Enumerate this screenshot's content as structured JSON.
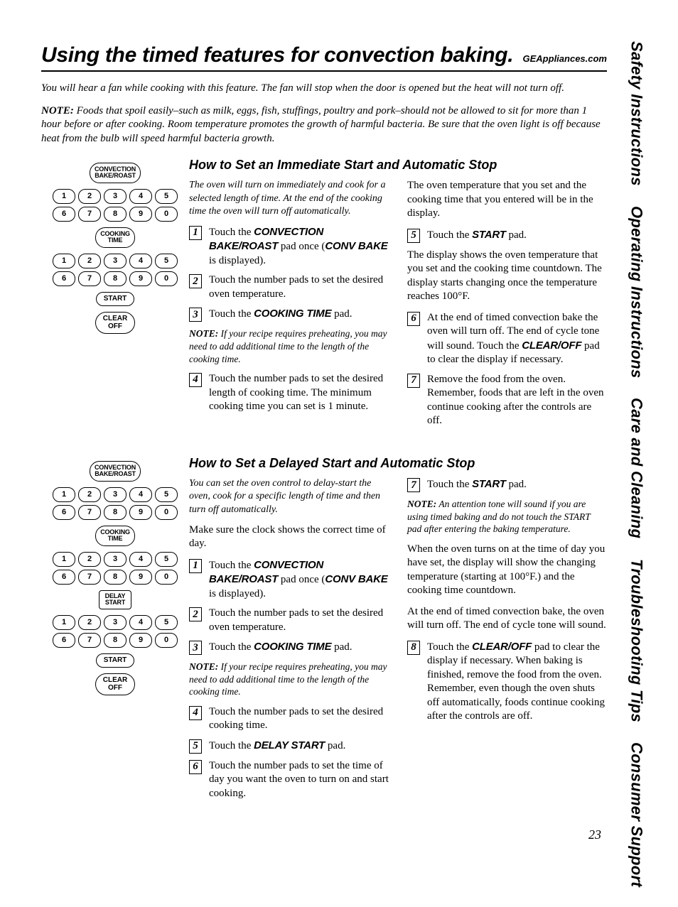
{
  "page": {
    "title": "Using the timed features for convection baking.",
    "site": "GEAppliances.com",
    "page_number": "23"
  },
  "tabs": [
    "Safety Instructions",
    "Operating Instructions",
    "Care and Cleaning",
    "Troubleshooting Tips",
    "Consumer Support"
  ],
  "intro": {
    "p1": "You will hear a fan while cooking with this feature. The fan will stop when the door is opened but the heat will not turn off.",
    "note_label": "NOTE:",
    "note_body": " Foods that spoil easily–such as milk, eggs, fish, stuffings, poultry and pork–should not be allowed to sit for more than 1 hour before or after cooking. Room temperature promotes the growth of harmful bacteria. Be sure that the oven light is off because heat from the bulb will speed harmful bacteria growth."
  },
  "buttons": {
    "conv": "CONVECTION\nBAKE/ROAST",
    "cooking": "COOKING\nTIME",
    "delay": "DELAY\nSTART",
    "start": "START",
    "clear": "CLEAR\nOFF",
    "digits": [
      "1",
      "2",
      "3",
      "4",
      "5",
      "6",
      "7",
      "8",
      "9",
      "0"
    ]
  },
  "sec1": {
    "head": "How to Set an Immediate Start and Automatic Stop",
    "lead": "The oven will turn on immediately and cook for a selected length of time. At the end of the cooking time the oven will turn off automatically.",
    "s1a": "Touch the ",
    "s1b": "CONVECTION BAKE/ROAST",
    "s1c": " pad once (",
    "s1d": "CONV BAKE",
    "s1e": " is displayed).",
    "s2": "Touch the number pads to set the desired oven temperature.",
    "s3a": "Touch the ",
    "s3b": "COOKING TIME",
    "s3c": " pad.",
    "note2_label": "NOTE:",
    "note2_body": " If your recipe requires preheating, you may need to add additional time to the length of the cooking time.",
    "s4": "Touch the number pads to set the desired length of cooking time. The minimum cooking time you can set is 1 minute.",
    "r_p1": "The oven temperature that you set and the cooking time that you entered will be in the display.",
    "s5a": "Touch the ",
    "s5b": "START",
    "s5c": " pad.",
    "r_p2": "The display shows the oven temperature that you set and the cooking time countdown. The display starts changing once the temperature reaches 100°F.",
    "s6a": "At the end of timed convection bake the oven will turn off. The end of cycle tone will sound. Touch the ",
    "s6b": "CLEAR/OFF",
    "s6c": " pad to clear the display if necessary.",
    "s7": "Remove the food from the oven. Remember, foods that are left in the oven continue cooking after the controls are off."
  },
  "sec2": {
    "head": "How to Set a Delayed Start and Automatic Stop",
    "lead": "You can set the oven control to delay-start the oven, cook for a specific length of time and then turn off automatically.",
    "p0": "Make sure the clock shows the correct time of day.",
    "s1a": "Touch the ",
    "s1b": "CONVECTION BAKE/ROAST",
    "s1c": " pad once (",
    "s1d": "CONV BAKE",
    "s1e": " is displayed).",
    "s2": "Touch the number pads to set the desired oven temperature.",
    "s3a": "Touch the ",
    "s3b": "COOKING TIME",
    "s3c": " pad.",
    "note_label": "NOTE:",
    "note_body": " If your recipe requires preheating, you may need to add additional time to the length of the cooking time.",
    "s4": "Touch the number pads to set the desired cooking time.",
    "s5a": "Touch the ",
    "s5b": "DELAY START",
    "s5c": " pad.",
    "s6": "Touch the number pads to set the time of day you want the oven to turn on and start cooking.",
    "r7a": "Touch the ",
    "r7b": "START",
    "r7c": " pad.",
    "rnote_label": "NOTE:",
    "rnote_body": " An attention tone will sound if you are using timed baking and do not touch the START pad after entering the baking temperature.",
    "r_p1": "When the oven turns on at the time of day you have set, the display will show the changing temperature (starting at 100°F.) and the cooking time countdown.",
    "r_p2": "At the end of timed convection bake, the oven will turn off. The end of cycle tone will sound.",
    "s8a": "Touch the ",
    "s8b": "CLEAR/OFF",
    "s8c": " pad to clear the display if necessary. When baking is finished, remove the food from the oven. Remember, even though the oven shuts off automatically, foods continue cooking after the controls are off."
  }
}
